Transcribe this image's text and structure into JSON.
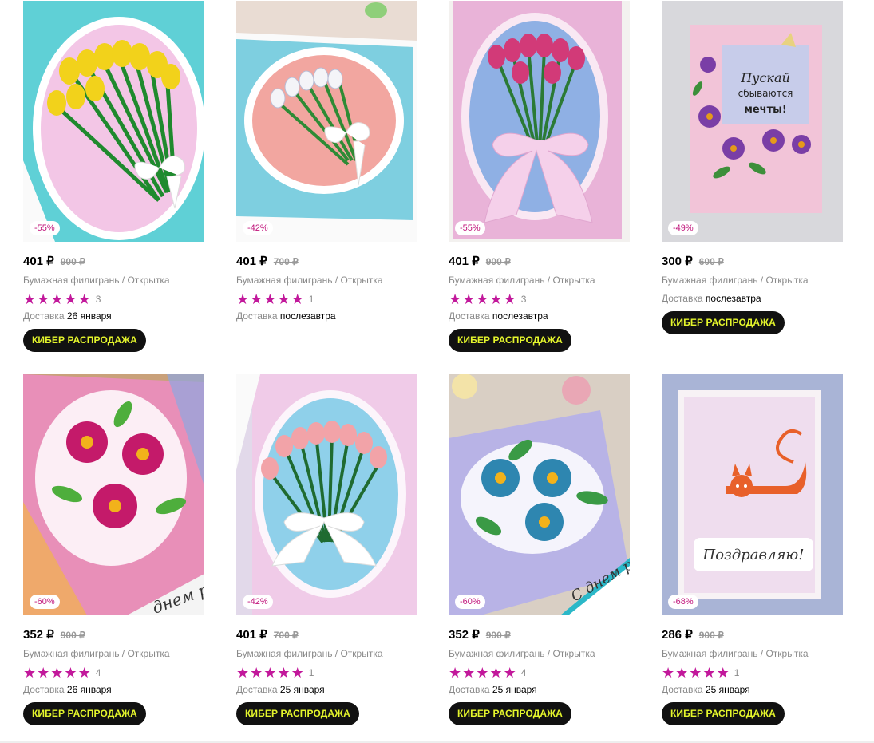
{
  "products": [
    {
      "discount": "-55%",
      "price": "401 ₽",
      "old_price": "900 ₽",
      "category": "Бумажная филигрань / Открытка",
      "rating_count": "3",
      "delivery_label": "Доставка",
      "delivery_date": "26 января",
      "promo": "КИБЕР РАСПРОДАЖА"
    },
    {
      "discount": "-42%",
      "price": "401 ₽",
      "old_price": "700 ₽",
      "category": "Бумажная филигрань / Открытка",
      "rating_count": "1",
      "delivery_label": "Доставка",
      "delivery_date": "послезавтра",
      "promo": ""
    },
    {
      "discount": "-55%",
      "price": "401 ₽",
      "old_price": "900 ₽",
      "category": "Бумажная филигрань / Открытка",
      "rating_count": "3",
      "delivery_label": "Доставка",
      "delivery_date": "послезавтра",
      "promo": "КИБЕР РАСПРОДАЖА"
    },
    {
      "discount": "-49%",
      "price": "300 ₽",
      "old_price": "600 ₽",
      "category": "Бумажная филигрань / Открытка",
      "rating_count": "",
      "delivery_label": "Доставка",
      "delivery_date": "послезавтра",
      "promo": "КИБЕР РАСПРОДАЖА"
    },
    {
      "discount": "-60%",
      "price": "352 ₽",
      "old_price": "900 ₽",
      "category": "Бумажная филигрань / Открытка",
      "rating_count": "4",
      "delivery_label": "Доставка",
      "delivery_date": "26 января",
      "promo": "КИБЕР РАСПРОДАЖА"
    },
    {
      "discount": "-42%",
      "price": "401 ₽",
      "old_price": "700 ₽",
      "category": "Бумажная филигрань / Открытка",
      "rating_count": "1",
      "delivery_label": "Доставка",
      "delivery_date": "25 января",
      "promo": "КИБЕР РАСПРОДАЖА"
    },
    {
      "discount": "-60%",
      "price": "352 ₽",
      "old_price": "900 ₽",
      "category": "Бумажная филигрань / Открытка",
      "rating_count": "4",
      "delivery_label": "Доставка",
      "delivery_date": "25 января",
      "promo": "КИБЕР РАСПРОДАЖА"
    },
    {
      "discount": "-68%",
      "price": "286 ₽",
      "old_price": "900 ₽",
      "category": "Бумажная филигрань / Открытка",
      "rating_count": "1",
      "delivery_label": "Доставка",
      "delivery_date": "25 января",
      "promo": "КИБЕР РАСПРОДАЖА"
    }
  ],
  "card_texts": {
    "card4_line1": "Пускай",
    "card4_line2": "сбываются",
    "card4_line3": "мечты!",
    "card5_text": "днем р",
    "card7_text": "С днем ро",
    "card8_text": "Поздравляю!"
  },
  "colors": {
    "star": "#c2189b",
    "discount_text": "#c0137a",
    "promo_bg": "#111111",
    "promo_text": "#e4f52c"
  }
}
